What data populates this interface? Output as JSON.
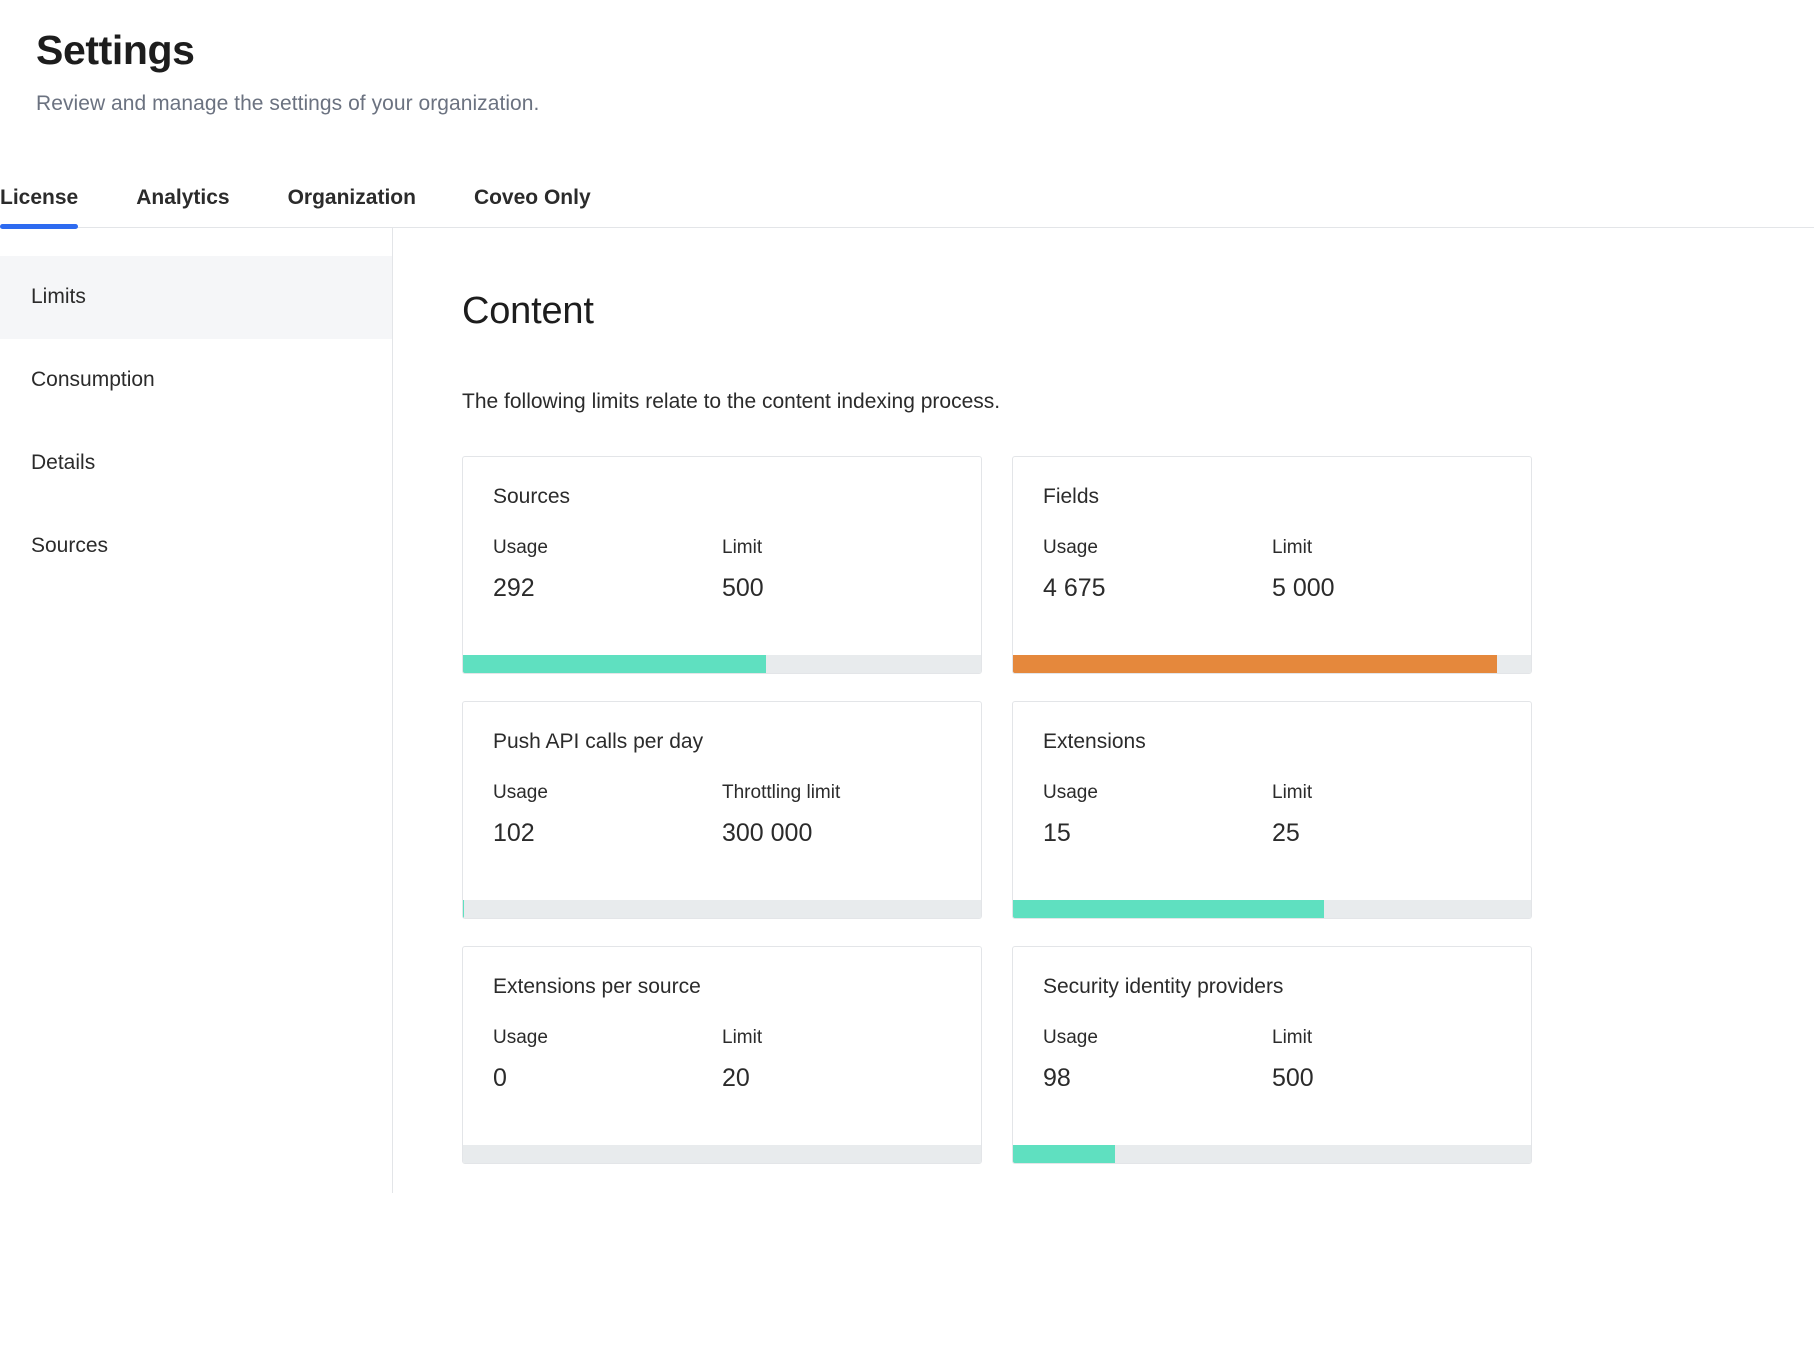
{
  "header": {
    "title": "Settings",
    "subtitle": "Review and manage the settings of your organization."
  },
  "tabs": [
    {
      "label": "License",
      "active": true
    },
    {
      "label": "Analytics",
      "active": false
    },
    {
      "label": "Organization",
      "active": false
    },
    {
      "label": "Coveo Only",
      "active": false
    }
  ],
  "sidebar": {
    "items": [
      {
        "label": "Limits",
        "active": true
      },
      {
        "label": "Consumption",
        "active": false
      },
      {
        "label": "Details",
        "active": false
      },
      {
        "label": "Sources",
        "active": false
      }
    ]
  },
  "main": {
    "section_title": "Content",
    "section_description": "The following limits relate to the content indexing process.",
    "cards": [
      {
        "title": "Sources",
        "usage_label": "Usage",
        "usage_value": "292",
        "limit_label": "Limit",
        "limit_value": "500",
        "percent": 58.4,
        "bar_color": "#5fe0c0",
        "state": "ok"
      },
      {
        "title": "Fields",
        "usage_label": "Usage",
        "usage_value": "4 675",
        "limit_label": "Limit",
        "limit_value": "5 000",
        "percent": 93.5,
        "bar_color": "#e5883c",
        "state": "warn"
      },
      {
        "title": "Push API calls per day",
        "usage_label": "Usage",
        "usage_value": "102",
        "limit_label": "Throttling limit",
        "limit_value": "300 000",
        "percent": 0.03,
        "bar_color": "#5fe0c0",
        "state": "ok"
      },
      {
        "title": "Extensions",
        "usage_label": "Usage",
        "usage_value": "15",
        "limit_label": "Limit",
        "limit_value": "25",
        "percent": 60,
        "bar_color": "#5fe0c0",
        "state": "ok"
      },
      {
        "title": "Extensions per source",
        "usage_label": "Usage",
        "usage_value": "0",
        "limit_label": "Limit",
        "limit_value": "20",
        "percent": 0,
        "bar_color": "#5fe0c0",
        "state": "ok"
      },
      {
        "title": "Security identity providers",
        "usage_label": "Usage",
        "usage_value": "98",
        "limit_label": "Limit",
        "limit_value": "500",
        "percent": 19.6,
        "bar_color": "#5fe0c0",
        "state": "ok"
      }
    ]
  },
  "colors": {
    "accent": "#2e6bf0",
    "progress_ok": "#5fe0c0",
    "progress_warn": "#e5883c",
    "progress_track": "#e8ebed",
    "border": "#e3e5e8",
    "sidebar_active_bg": "#f5f6f8"
  }
}
